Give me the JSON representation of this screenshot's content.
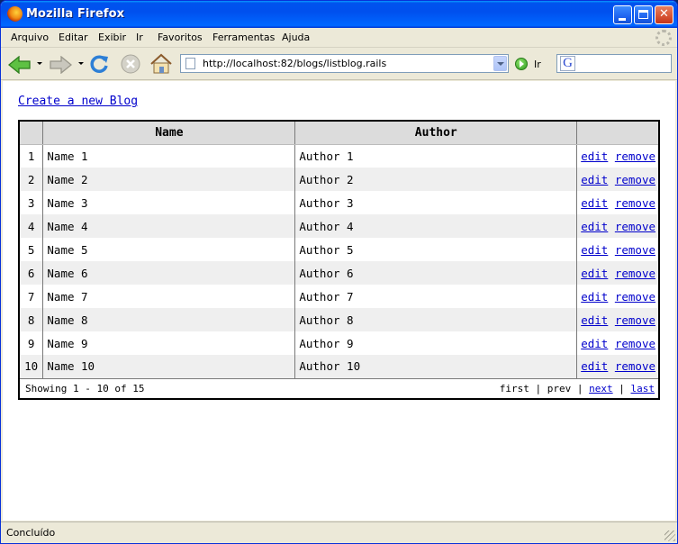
{
  "window": {
    "title": "Mozilla Firefox"
  },
  "menu": {
    "items": [
      "Arquivo",
      "Editar",
      "Exibir",
      "Ir",
      "Favoritos",
      "Ferramentas",
      "Ajuda"
    ]
  },
  "navbar": {
    "url": "http://localhost:82/blogs/listblog.rails",
    "go_label": "Ir",
    "search_value": ""
  },
  "page": {
    "create_link": "Create a new Blog",
    "columns": [
      "",
      "Name",
      "Author",
      ""
    ],
    "rows": [
      {
        "num": "1",
        "name": "Name 1",
        "author": "Author 1"
      },
      {
        "num": "2",
        "name": "Name 2",
        "author": "Author 2"
      },
      {
        "num": "3",
        "name": "Name 3",
        "author": "Author 3"
      },
      {
        "num": "4",
        "name": "Name 4",
        "author": "Author 4"
      },
      {
        "num": "5",
        "name": "Name 5",
        "author": "Author 5"
      },
      {
        "num": "6",
        "name": "Name 6",
        "author": "Author 6"
      },
      {
        "num": "7",
        "name": "Name 7",
        "author": "Author 7"
      },
      {
        "num": "8",
        "name": "Name 8",
        "author": "Author 8"
      },
      {
        "num": "9",
        "name": "Name 9",
        "author": "Author 9"
      },
      {
        "num": "10",
        "name": "Name 10",
        "author": "Author 10"
      }
    ],
    "edit_label": "edit",
    "remove_label": "remove",
    "pager": {
      "showing": "Showing 1 - 10 of 15",
      "first": "first",
      "prev": "prev",
      "next": "next",
      "last": "last",
      "separator": "|"
    }
  },
  "status": {
    "text": "Concluído"
  },
  "colors": {
    "titlebar": "#0054e3",
    "link": "#0000cc",
    "header_bg": "#dcdcdc",
    "alt_row_bg": "#efefef"
  }
}
